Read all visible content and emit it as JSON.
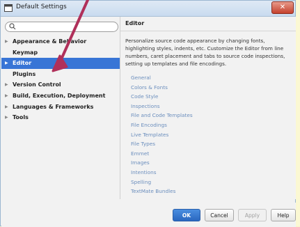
{
  "window": {
    "title": "Default Settings",
    "close_label": "✕"
  },
  "search": {
    "placeholder": ""
  },
  "tree": [
    {
      "label": "Appearance & Behavior",
      "expandable": true,
      "selected": false
    },
    {
      "label": "Keymap",
      "expandable": false,
      "selected": false
    },
    {
      "label": "Editor",
      "expandable": true,
      "selected": true
    },
    {
      "label": "Plugins",
      "expandable": false,
      "selected": false
    },
    {
      "label": "Version Control",
      "expandable": true,
      "selected": false
    },
    {
      "label": "Build, Execution, Deployment",
      "expandable": true,
      "selected": false
    },
    {
      "label": "Languages & Frameworks",
      "expandable": true,
      "selected": false
    },
    {
      "label": "Tools",
      "expandable": true,
      "selected": false
    }
  ],
  "editor": {
    "title": "Editor",
    "description": "Personalize source code appearance by changing fonts, highlighting styles, indents, etc. Customize the Editor from line numbers, caret placement and tabs to source code inspections, setting up templates and file encodings.",
    "links": [
      "General",
      "Colors & Fonts",
      "Code Style",
      "Inspections",
      "File and Code Templates",
      "File Encodings",
      "Live Templates",
      "File Types",
      "Emmet",
      "Images",
      "Intentions",
      "Spelling",
      "TextMate Bundles"
    ]
  },
  "footer": {
    "ok_label": "OK",
    "cancel_label": "Cancel",
    "apply_label": "Apply",
    "help_label": "Help"
  },
  "colors": {
    "selection": "#3875d6",
    "link": "#6b8ebd",
    "annotation_arrow": "#b0305a",
    "ok_button": "#2a67c0"
  }
}
